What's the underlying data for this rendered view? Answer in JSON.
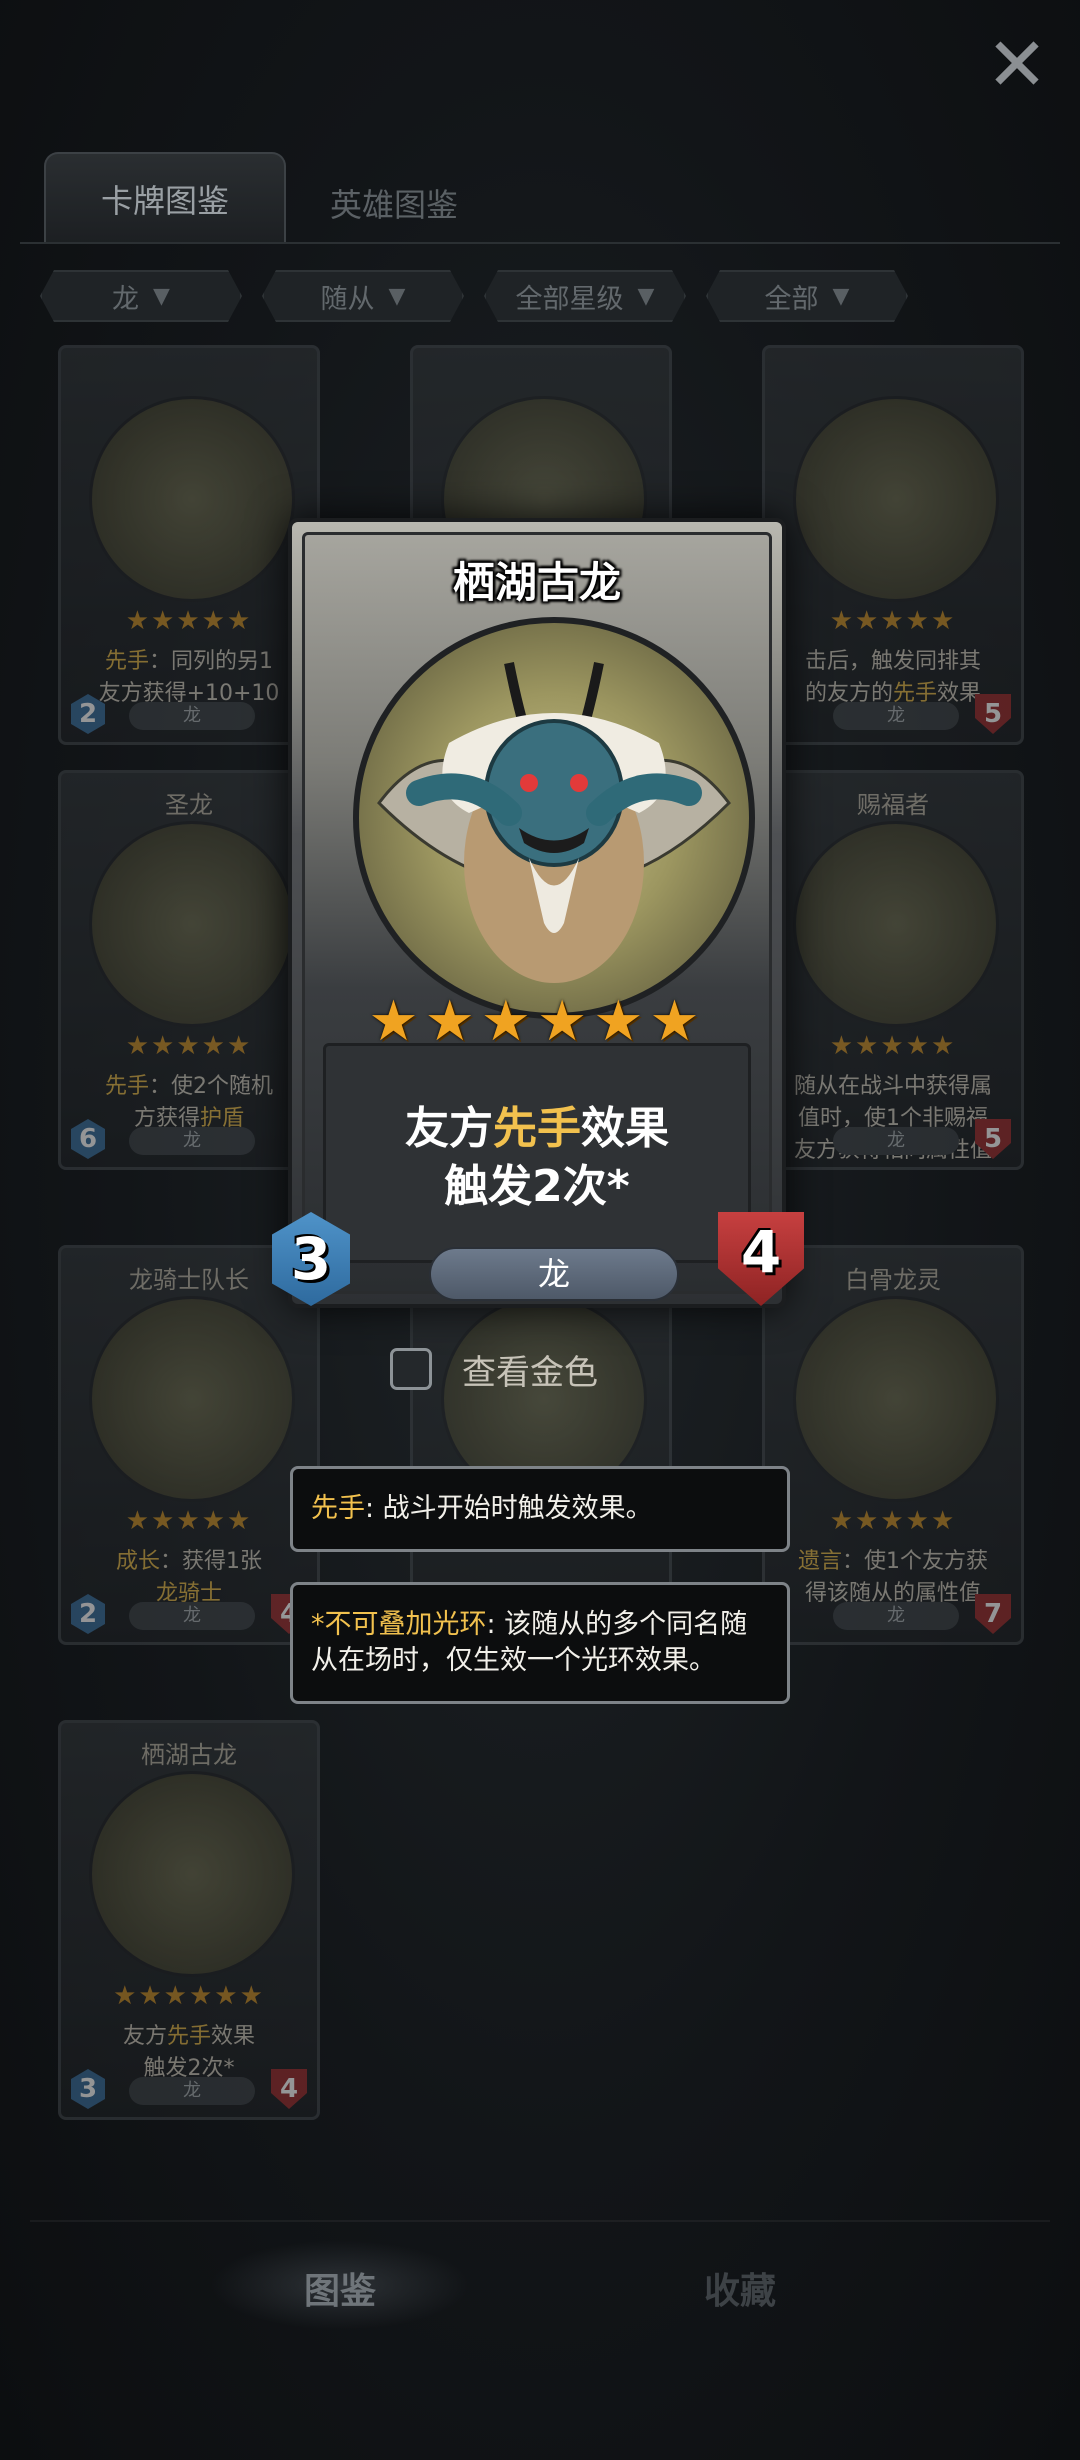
{
  "tabs": {
    "active": "卡牌图鉴",
    "inactive": "英雄图鉴"
  },
  "filters": [
    {
      "label": "龙"
    },
    {
      "label": "随从"
    },
    {
      "label": "全部星级"
    },
    {
      "label": "全部"
    }
  ],
  "grid_cards": [
    {
      "name": "",
      "stars": "★★★★★",
      "desc_html": "<span class='hl'>先手</span>：同列的另1<br>友方获得+10+10",
      "cost": "2",
      "attack": "",
      "type": "龙"
    },
    {
      "name": "",
      "stars": "",
      "desc_html": "",
      "cost": "",
      "attack": "",
      "type": ""
    },
    {
      "name": "",
      "stars": "★★★★★",
      "desc_html": "击后，触发同排其<br>的友方的<span class='hl'>先手</span>效果",
      "cost": "",
      "attack": "5",
      "type": "龙"
    },
    {
      "name": "圣龙",
      "stars": "★★★★★",
      "desc_html": "<span class='hl'>先手</span>：使2个随机<br>方获得<span class='hl'>护盾</span>",
      "cost": "6",
      "attack": "",
      "type": "龙"
    },
    {
      "name": "赐福者",
      "stars": "★★★★★",
      "desc_html": "随从在战斗中获得属<br>值时，使1个非赐福<br>友方获得相同属性值",
      "cost": "",
      "attack": "5",
      "type": "龙"
    },
    {
      "name": "龙骑士队长",
      "stars": "★★★★★",
      "desc_html": "<span class='hl'>成长</span>：获得1张<br><span class='hl'>龙骑士</span>",
      "cost": "2",
      "attack": "4",
      "type": "龙"
    },
    {
      "name": "",
      "stars": "★★★★★",
      "desc_html": "",
      "cost": "",
      "attack": "",
      "type": ""
    },
    {
      "name": "白骨龙灵",
      "stars": "★★★★★",
      "desc_html": "<span class='hl'>遗言</span>：使1个友方获<br>得该随从的属性值",
      "cost": "",
      "attack": "7",
      "type": "龙"
    },
    {
      "name": "栖湖古龙",
      "stars": "★★★★★★",
      "desc_html": "友方<span class='hl'>先手</span>效果<br>触发2次*",
      "cost": "3",
      "attack": "4",
      "type": "龙"
    }
  ],
  "main_card": {
    "title": "栖湖古龙",
    "stars": "★★★★★★",
    "desc_prefix": "友方",
    "desc_keyword": "先手",
    "desc_suffix": "效果",
    "desc_line2": "触发2次*",
    "type": "龙",
    "cost": "3",
    "attack": "4"
  },
  "gold_toggle": {
    "label": "查看金色",
    "checked": false
  },
  "tooltips": {
    "first": {
      "keyword": "先手",
      "text": ": 战斗开始时触发效果。"
    },
    "second": {
      "keyword": "*不可叠加光环",
      "text": ": 该随从的多个同名随从在场时，仅生效一个光环效果。"
    }
  },
  "bottom_nav": [
    {
      "label": "图鉴",
      "active": true
    },
    {
      "label": "收藏",
      "active": false
    }
  ],
  "colors": {
    "highlight": "#f2c14e",
    "star": "#f0a321",
    "cost": "#3b7fb8",
    "attack": "#b53535"
  }
}
